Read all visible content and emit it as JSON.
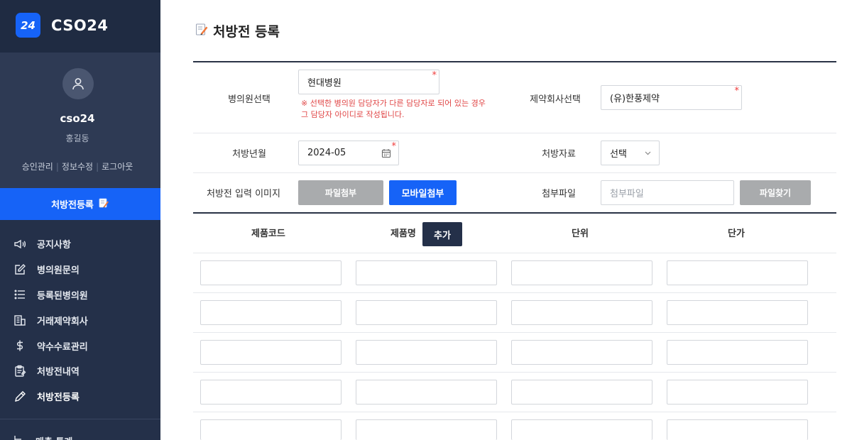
{
  "brand": {
    "logo": "24",
    "name": "CSO24"
  },
  "profile": {
    "avatar_icon": "user-icon",
    "id": "cso24",
    "name": "홍길동",
    "links": [
      "승인관리",
      "정보수정",
      "로그아웃"
    ]
  },
  "active_menu": {
    "label": "처방전등록",
    "icon": "prescription-pencil-icon"
  },
  "menu": [
    {
      "label": "공지사항",
      "icon": "megaphone-icon"
    },
    {
      "label": "병의원문의",
      "icon": "edit-icon"
    },
    {
      "label": "등록된병의원",
      "icon": "list-icon"
    },
    {
      "label": "거래제약회사",
      "icon": "building-icon"
    },
    {
      "label": "약수수료관리",
      "icon": "dollar-icon"
    },
    {
      "label": "처방전내역",
      "icon": "clipboard-icon"
    },
    {
      "label": "처방전등록",
      "icon": "pencil-icon"
    }
  ],
  "menu_cut": {
    "label": "매출 통계",
    "icon": "chart-icon"
  },
  "page": {
    "title": "처방전 등록",
    "title_icon": "memo-pencil-icon"
  },
  "form": {
    "hospital_label": "병의원선택",
    "hospital_value": "현대병원",
    "hospital_notice_1": "※ 선택한 병의원 담당자가 다른 담당자로 되어 있는 경우",
    "hospital_notice_2": "그 담당자 아이디로 작성됩니다.",
    "pharma_label": "제약회사선택",
    "pharma_value": "(유)한풍제약",
    "month_label": "처방년월",
    "month_value": "2024-05",
    "material_label": "처방자료",
    "material_value": "선택",
    "image_label": "처방전 입력 이미지",
    "file_attach_label": "파일첨부",
    "mobile_attach_label": "모바일첨부",
    "attach_label": "첨부파일",
    "attach_placeholder": "첨부파일",
    "find_file_label": "파일찾기",
    "required_mark": "*"
  },
  "product_table": {
    "columns": [
      "제품코드",
      "제품명",
      "단위",
      "단가"
    ],
    "add_label": "추가",
    "rows": [
      [
        "",
        "",
        "",
        ""
      ],
      [
        "",
        "",
        "",
        ""
      ],
      [
        "",
        "",
        "",
        ""
      ],
      [
        "",
        "",
        "",
        ""
      ],
      [
        "",
        "",
        "",
        ""
      ]
    ]
  }
}
